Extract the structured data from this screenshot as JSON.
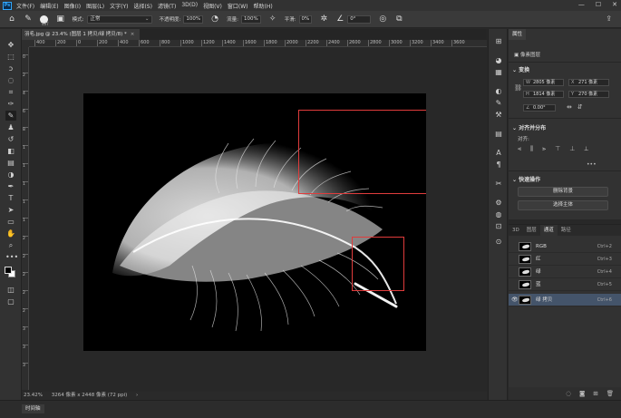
{
  "menubar": {
    "logo": "Ps",
    "items": [
      "文件(F)",
      "编辑(E)",
      "图像(I)",
      "图层(L)",
      "文字(Y)",
      "选择(S)",
      "滤镜(T)",
      "3D(D)",
      "视图(V)",
      "窗口(W)",
      "帮助(H)"
    ],
    "win_min": "—",
    "win_max": "☐",
    "win_close": "✕"
  },
  "options": {
    "brush_size": "467",
    "mode_label": "模式:",
    "mode_value": "正常",
    "opacity_label": "不透明度:",
    "opacity_value": "100%",
    "flow_label": "流量:",
    "flow_value": "100%",
    "smooth_label": "平滑:",
    "smooth_value": "0%",
    "angle_value": "0°"
  },
  "document": {
    "tab_title": "羽毛.jpg @ 23.4% (图层 1 拷贝/绿 拷贝/8) *",
    "close": "×"
  },
  "ruler": {
    "top_ticks": [
      "400",
      "200",
      "0",
      "200",
      "400",
      "600",
      "800",
      "1000",
      "1200",
      "1400",
      "1600",
      "1800",
      "2000",
      "2200",
      "2400",
      "2600",
      "2800",
      "3000",
      "3200",
      "3400",
      "3600"
    ],
    "left_ticks": [
      "0",
      "2",
      "4",
      "6",
      "8",
      "1",
      "1",
      "1",
      "1",
      "1",
      "2",
      "2",
      "2",
      "2",
      "2",
      "3",
      "3",
      "3"
    ]
  },
  "status": {
    "zoom": "23.42%",
    "doc_info": "3264 像素 x 2448 像素 (72 ppi)",
    "arrow": "›"
  },
  "timeline": {
    "label": "时间轴"
  },
  "properties": {
    "tab": "属性",
    "subtitle": "像素图层",
    "transform_title": "变换",
    "w_label": "W",
    "w_value": "2805 像素",
    "x_label": "X",
    "x_value": "271 像素",
    "h_label": "H",
    "h_value": "1814 像素",
    "y_label": "Y",
    "y_value": "270 像素",
    "angle_value": "0.00°",
    "align_title": "对齐并分布",
    "align_sub": "对齐:",
    "more": "•••",
    "quick_title": "快速操作",
    "btn_remove_bg": "删除背景",
    "btn_select_subject": "选择主体"
  },
  "channels": {
    "tabs": [
      "3D",
      "图层",
      "通道",
      "路径"
    ],
    "rows": [
      {
        "name": "RGB",
        "shortcut": "Ctrl+2"
      },
      {
        "name": "红",
        "shortcut": "Ctrl+3"
      },
      {
        "name": "绿",
        "shortcut": "Ctrl+4"
      },
      {
        "name": "蓝",
        "shortcut": "Ctrl+5"
      },
      {
        "name": "绿 拷贝",
        "shortcut": "Ctrl+6"
      }
    ],
    "eye": "👁"
  },
  "colors": {
    "selection": "#e03c3c",
    "selected_row": "#44546a",
    "accent": "#31a8ff"
  }
}
